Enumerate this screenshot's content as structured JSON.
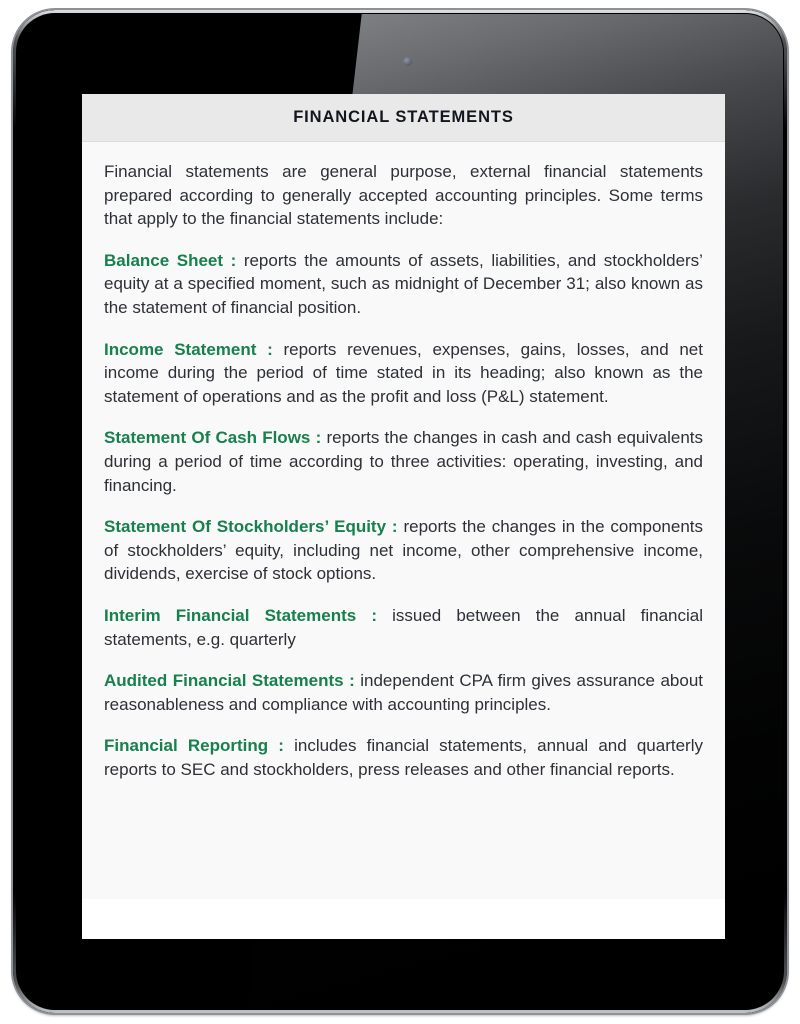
{
  "device": {
    "type": "tablet",
    "camera_icon": "camera-dot-icon"
  },
  "card": {
    "header_title": "FINANCIAL STATEMENTS",
    "accent_color": "#17804d",
    "header_bg": "#e9e9e9",
    "body_bg": "#f9f9f9",
    "text_color": "#2d3036"
  },
  "content": {
    "intro": "Financial statements are general purpose, external financial statements prepared according to generally accepted accounting principles. Some terms that apply to the financial statements include:",
    "terms": [
      {
        "term": "Balance Sheet",
        "colon": ":",
        "definition": "reports the amounts of assets, liabilities, and stockholders’ equity at a specified moment, such as midnight of December 31; also known as the statement of financial position."
      },
      {
        "term": "Income Statement",
        "colon": ":",
        "definition": "reports revenues, expenses, gains, losses, and net income during the period of time stated in its heading; also known as the statement of operations and as the profit and loss (P&L) statement."
      },
      {
        "term": "Statement Of Cash Flows",
        "colon": ":",
        "definition": "reports the changes in cash and cash equivalents during a period of time according to three activities: operating, investing, and financing."
      },
      {
        "term": "Statement Of Stockholders’ Equity",
        "colon": ":",
        "definition": "reports the changes in the components of stockholders’ equity, including net income, other comprehensive income, dividends, exercise of stock options."
      },
      {
        "term": "Interim Financial Statements",
        "colon": ":",
        "definition": "issued between the annual financial statements, e.g. quarterly"
      },
      {
        "term": "Audited Financial Statements",
        "colon": ":",
        "definition": "independent CPA firm gives assurance about reasonableness and compliance with accounting principles."
      },
      {
        "term": "Financial Reporting",
        "colon": ":",
        "definition": "includes financial statements, annual and quarterly reports to SEC and stockholders, press releases and other financial reports."
      }
    ]
  }
}
